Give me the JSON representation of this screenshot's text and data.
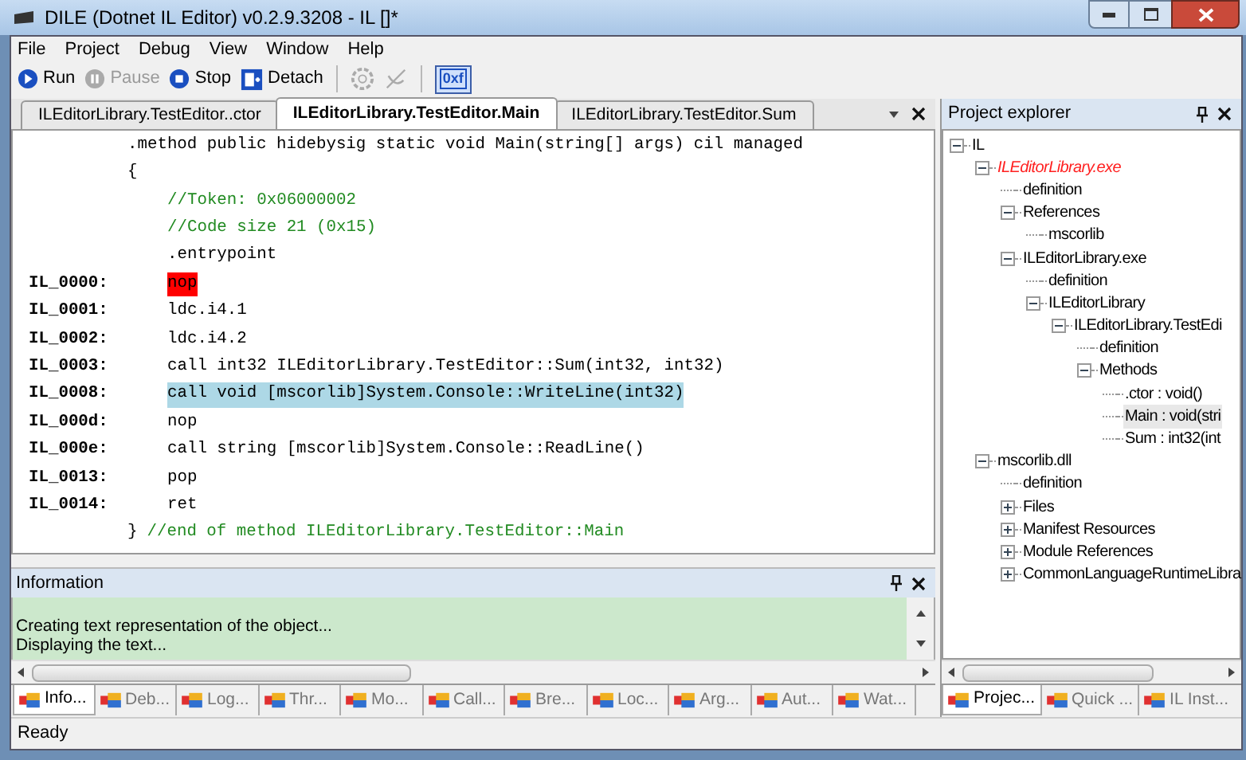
{
  "window": {
    "title": "DILE (Dotnet IL Editor) v0.2.9.3208 - IL []*"
  },
  "menu": [
    "File",
    "Project",
    "Debug",
    "View",
    "Window",
    "Help"
  ],
  "toolbar": [
    {
      "kind": "run",
      "label": "Run",
      "disabled": false
    },
    {
      "kind": "pause",
      "label": "Pause",
      "disabled": true
    },
    {
      "kind": "stop",
      "label": "Stop",
      "disabled": false
    },
    {
      "kind": "detach",
      "label": "Detach",
      "disabled": false
    },
    {
      "kind": "separator"
    },
    {
      "kind": "gear",
      "disabled": true
    },
    {
      "kind": "satellite",
      "disabled": true
    },
    {
      "kind": "separator"
    },
    {
      "kind": "hex",
      "label": "0xf",
      "checked": true
    }
  ],
  "editor_tabs": [
    {
      "label": "ILEditorLibrary.TestEditor..ctor",
      "selected": false
    },
    {
      "label": "ILEditorLibrary.TestEditor.Main",
      "selected": true
    },
    {
      "label": "ILEditorLibrary.TestEditor.Sum",
      "selected": false
    }
  ],
  "code": [
    {
      "nested": false,
      "breakpoint": false,
      "current": false,
      "code": ".method public hidebysig static void Main(string[] args) cil managed"
    },
    {
      "nested": false,
      "breakpoint": false,
      "current": false,
      "code": "{"
    },
    {
      "nested": true,
      "breakpoint": false,
      "current": false,
      "comment": "//Token: 0x06000002"
    },
    {
      "nested": true,
      "breakpoint": false,
      "current": false,
      "comment": "//Code size 21 (0x15)"
    },
    {
      "nested": true,
      "breakpoint": false,
      "current": false,
      "code": ".entrypoint"
    },
    {
      "nested": true,
      "breakpoint": true,
      "current": false,
      "label": "IL_0000:",
      "code": "nop"
    },
    {
      "nested": true,
      "breakpoint": false,
      "current": false,
      "label": "IL_0001:",
      "code": "ldc.i4.1"
    },
    {
      "nested": true,
      "breakpoint": false,
      "current": false,
      "label": "IL_0002:",
      "code": "ldc.i4.2"
    },
    {
      "nested": true,
      "breakpoint": false,
      "current": false,
      "label": "IL_0003:",
      "code": "call int32 ILEditorLibrary.TestEditor::Sum(int32, int32)"
    },
    {
      "nested": true,
      "breakpoint": false,
      "current": true,
      "label": "IL_0008:",
      "code": "call void [mscorlib]System.Console::WriteLine(int32)"
    },
    {
      "nested": true,
      "breakpoint": false,
      "current": false,
      "label": "IL_000d:",
      "code": "nop"
    },
    {
      "nested": true,
      "breakpoint": false,
      "current": false,
      "label": "IL_000e:",
      "code": "call string [mscorlib]System.Console::ReadLine()"
    },
    {
      "nested": true,
      "breakpoint": false,
      "current": false,
      "label": "IL_0013:",
      "code": "pop"
    },
    {
      "nested": true,
      "breakpoint": false,
      "current": false,
      "label": "IL_0014:",
      "code": "ret"
    },
    {
      "nested": false,
      "breakpoint": false,
      "current": false,
      "code": "}",
      "comment": "//end of method ILEditorLibrary.TestEditor::Main"
    }
  ],
  "information": {
    "title": "Information",
    "lines": [
      "Creating text representation of the object...",
      "Displaying the text..."
    ]
  },
  "bottom_tabs": [
    {
      "label": "Info...",
      "selected": true
    },
    {
      "label": "Deb...",
      "selected": false
    },
    {
      "label": "Log...",
      "selected": false
    },
    {
      "label": "Thr...",
      "selected": false
    },
    {
      "label": "Mo...",
      "selected": false
    },
    {
      "label": "Call...",
      "selected": false
    },
    {
      "label": "Bre...",
      "selected": false
    },
    {
      "label": "Loc...",
      "selected": false
    },
    {
      "label": "Arg...",
      "selected": false
    },
    {
      "label": "Aut...",
      "selected": false
    },
    {
      "label": "Wat...",
      "selected": false
    }
  ],
  "project_explorer": {
    "title": "Project explorer",
    "tree": [
      {
        "label": "IL",
        "expanded": true,
        "active": false,
        "selected": false,
        "children": [
          {
            "label": "ILEditorLibrary.exe",
            "expanded": true,
            "active": true,
            "selected": false,
            "children": [
              {
                "label": "definition",
                "active": false,
                "selected": false
              },
              {
                "label": "References",
                "expanded": true,
                "active": false,
                "selected": false,
                "children": [
                  {
                    "label": "mscorlib",
                    "active": false,
                    "selected": false
                  }
                ]
              },
              {
                "label": "ILEditorLibrary.exe",
                "expanded": true,
                "active": false,
                "selected": false,
                "children": [
                  {
                    "label": "definition",
                    "active": false,
                    "selected": false
                  },
                  {
                    "label": "ILEditorLibrary",
                    "expanded": true,
                    "active": false,
                    "selected": false,
                    "children": [
                      {
                        "label": "ILEditorLibrary.TestEdi",
                        "expanded": true,
                        "active": false,
                        "selected": false,
                        "children": [
                          {
                            "label": "definition",
                            "active": false,
                            "selected": false
                          },
                          {
                            "label": "Methods",
                            "expanded": true,
                            "active": false,
                            "selected": false,
                            "children": [
                              {
                                "label": ".ctor : void()",
                                "active": false,
                                "selected": false
                              },
                              {
                                "label": "Main : void(stri",
                                "active": false,
                                "selected": true
                              },
                              {
                                "label": "Sum : int32(int",
                                "active": false,
                                "selected": false
                              }
                            ]
                          }
                        ]
                      }
                    ]
                  }
                ]
              }
            ]
          },
          {
            "label": "mscorlib.dll",
            "expanded": true,
            "active": false,
            "selected": false,
            "children": [
              {
                "label": "definition",
                "active": false,
                "selected": false
              },
              {
                "label": "Files",
                "expanded": false,
                "active": false,
                "selected": false
              },
              {
                "label": "Manifest Resources",
                "expanded": false,
                "active": false,
                "selected": false
              },
              {
                "label": "Module References",
                "expanded": false,
                "active": false,
                "selected": false
              },
              {
                "label": "CommonLanguageRuntimeLibra",
                "expanded": false,
                "active": false,
                "selected": false
              }
            ]
          }
        ]
      }
    ]
  },
  "side_tabs": [
    {
      "label": "Projec...",
      "selected": true
    },
    {
      "label": "Quick ...",
      "selected": false
    },
    {
      "label": "IL Inst...",
      "selected": false
    }
  ],
  "status_bar": "Ready"
}
